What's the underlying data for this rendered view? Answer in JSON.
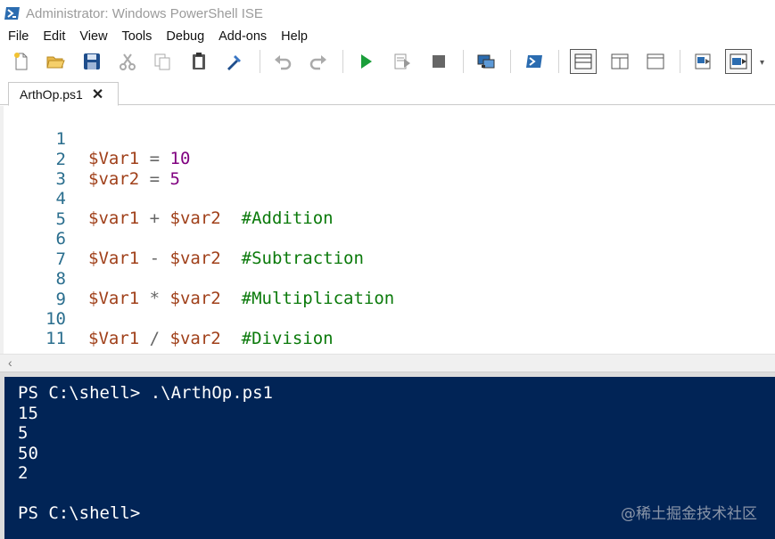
{
  "window": {
    "title": "Administrator: Windows PowerShell ISE",
    "app_icon": "powershell-icon"
  },
  "menu": {
    "items": [
      "File",
      "Edit",
      "View",
      "Tools",
      "Debug",
      "Add-ons",
      "Help"
    ]
  },
  "toolbar": {
    "buttons": [
      {
        "name": "new-file-icon"
      },
      {
        "name": "open-folder-icon"
      },
      {
        "name": "save-icon"
      },
      {
        "name": "cut-icon"
      },
      {
        "name": "copy-icon"
      },
      {
        "name": "paste-icon"
      },
      {
        "name": "clear-console-icon"
      },
      {
        "name": "undo-icon"
      },
      {
        "name": "redo-icon"
      },
      {
        "name": "run-script-icon"
      },
      {
        "name": "run-selection-icon"
      },
      {
        "name": "stop-icon"
      },
      {
        "name": "remote-powershell-icon"
      },
      {
        "name": "start-powershell-icon"
      },
      {
        "name": "show-script-pane-top-icon"
      },
      {
        "name": "show-script-pane-right-icon"
      },
      {
        "name": "show-script-pane-maximized-icon"
      },
      {
        "name": "show-command-window-icon"
      },
      {
        "name": "show-command-addon-icon"
      }
    ],
    "colors": {
      "run": "#1a9e3a",
      "save": "#1f4e8c",
      "stop": "#555555"
    }
  },
  "tabs": [
    {
      "label": "ArthOp.ps1",
      "close": "✕"
    }
  ],
  "editor": {
    "lines": [
      {
        "n": "1",
        "var1": "$Var1",
        "op": " = ",
        "rhs": "10",
        "comment": ""
      },
      {
        "n": "2",
        "var1": "$var2",
        "op": " = ",
        "rhs": "5",
        "comment": ""
      },
      {
        "n": "3"
      },
      {
        "n": "4",
        "var1": "$var1",
        "op": " + ",
        "var2": "$var2",
        "comment": "#Addition"
      },
      {
        "n": "5"
      },
      {
        "n": "6",
        "var1": "$Var1",
        "op": " - ",
        "var2": "$var2",
        "comment": "#Subtraction"
      },
      {
        "n": "7"
      },
      {
        "n": "8",
        "var1": "$Var1",
        "op": " * ",
        "var2": "$var2",
        "comment": "#Multiplication"
      },
      {
        "n": "9"
      },
      {
        "n": "10",
        "var1": "$Var1",
        "op": " / ",
        "var2": "$var2",
        "comment": "#Division"
      },
      {
        "n": "11"
      }
    ]
  },
  "console": {
    "lines": [
      "PS C:\\shell> .\\ArthOp.ps1",
      "15",
      "5",
      "50",
      "2",
      "",
      "PS C:\\shell>"
    ],
    "background": "#012456"
  },
  "watermark": "@稀土掘金技术社区"
}
